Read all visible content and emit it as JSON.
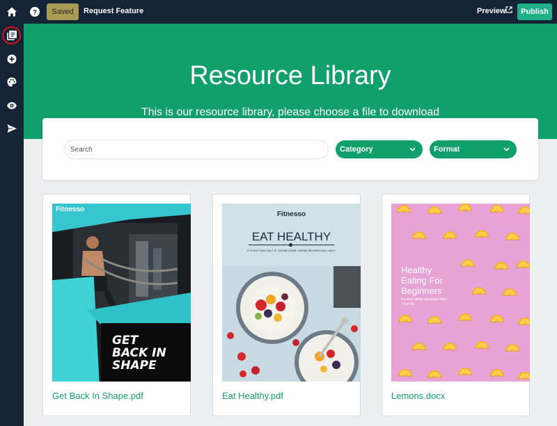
{
  "topbar": {
    "saved_label": "Saved",
    "request_feature_label": "Request Feature",
    "preview_label": "Preview",
    "publish_label": "Publish"
  },
  "sidebar": {
    "icons": [
      "home-icon",
      "resource-library-icon",
      "add-icon",
      "palette-icon",
      "eye-icon",
      "send-icon"
    ]
  },
  "hero": {
    "title": "Resource Library",
    "subtitle": "This is our resource library, please choose a file to download"
  },
  "filters": {
    "search_placeholder": "Search",
    "category_label": "Category",
    "format_label": "Format"
  },
  "resources": [
    {
      "title": "Get Back In Shape.pdf",
      "cover": {
        "brand": "Fitnesso",
        "slogan_lines": [
          "GET",
          "BACK IN",
          "SHAPE"
        ]
      }
    },
    {
      "title": "Eat Healthy.pdf",
      "cover": {
        "brand": "Fitnesso",
        "headline": "EAT HEALTHY",
        "tagline": "IT'S NOT EASY BUT IT CAN BE DONE. THESE RECIPES WILL HELP"
      }
    },
    {
      "title": "Lemons.docx",
      "cover": {
        "headline_lines": [
          "Healthy",
          "Eating For",
          "Beginners"
        ],
        "sub_lines": [
          "It's easy when you know how.",
          "Trust Me."
        ]
      }
    }
  ],
  "colors": {
    "nav": "#142335",
    "brand_green": "#11a06b",
    "saved_bg": "#a99a55",
    "publish_bg": "#1fb08a",
    "highlight_red": "#d21414"
  }
}
